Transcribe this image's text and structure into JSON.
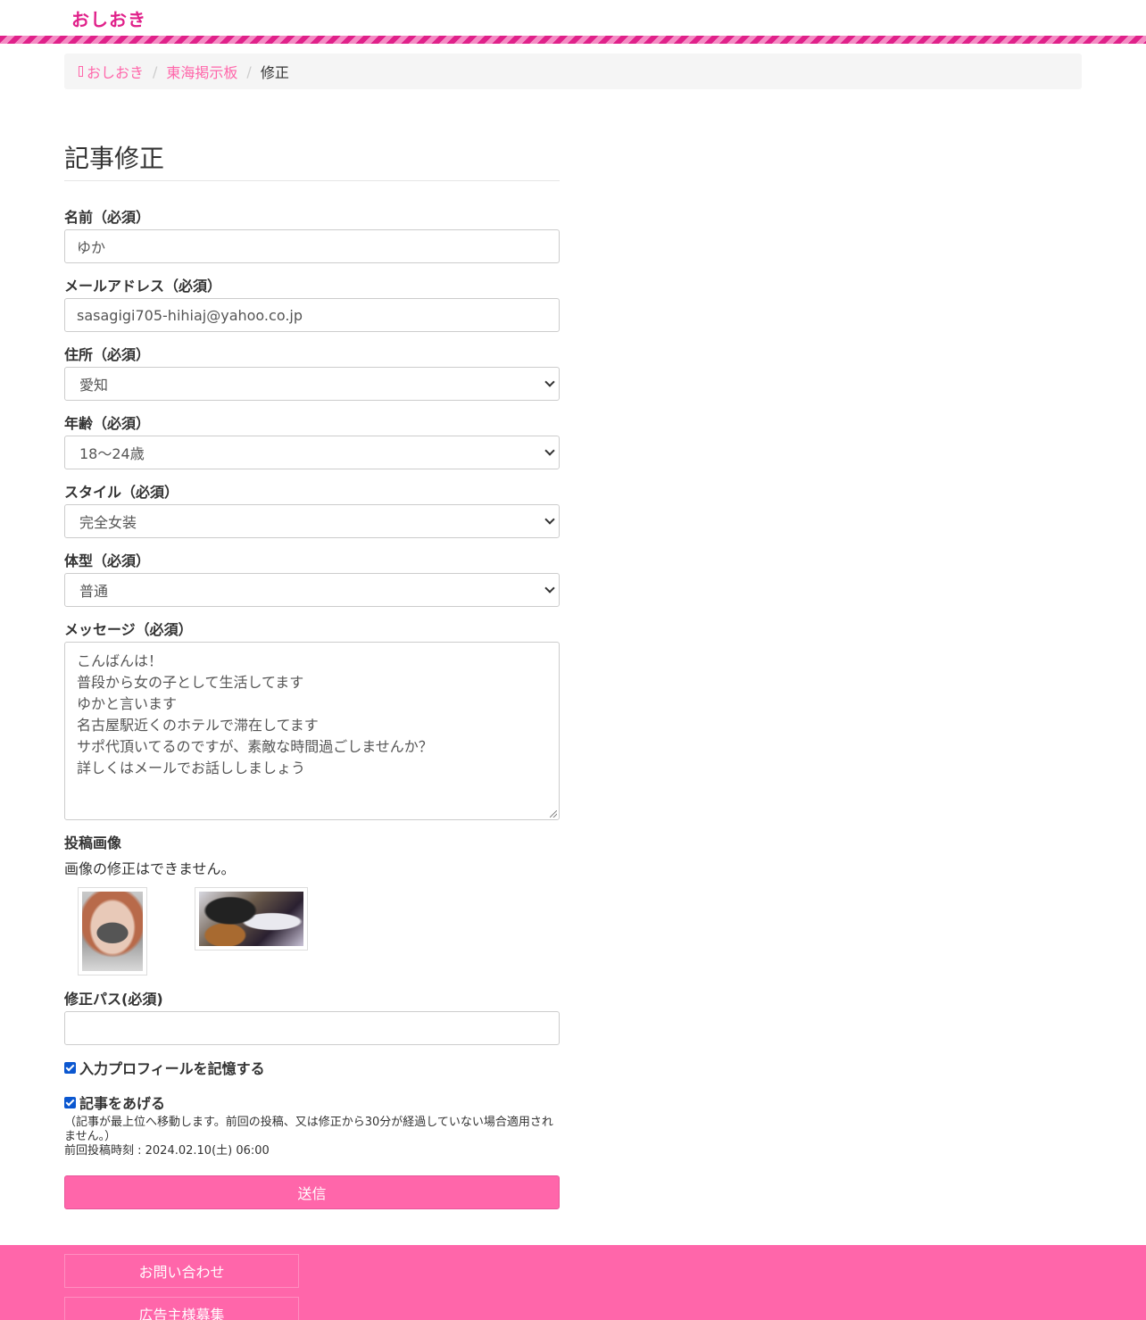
{
  "header": {
    "logo": "おしおき"
  },
  "breadcrumb": {
    "home": "おしおき",
    "board": "東海掲示板",
    "current": "修正"
  },
  "form": {
    "title": "記事修正",
    "name": {
      "label": "名前（必須）",
      "value": "ゆか"
    },
    "email": {
      "label": "メールアドレス（必須）",
      "value": "sasagigi705-hihiaj@yahoo.co.jp"
    },
    "address": {
      "label": "住所（必須）",
      "value": "愛知"
    },
    "age": {
      "label": "年齢（必須）",
      "value": "18〜24歳"
    },
    "style": {
      "label": "スタイル（必須）",
      "value": "完全女装"
    },
    "body_type": {
      "label": "体型（必須）",
      "value": "普通"
    },
    "message": {
      "label": "メッセージ（必須）",
      "lines": [
        "こんばんは！",
        "普段から女の子として生活してます",
        "ゆかと言います",
        "名古屋駅近くのホテルで滞在してます",
        "サポ代頂いてるのですが、素敵な時間過ごしませんか？",
        "詳しくはメールでお話ししましょう"
      ]
    },
    "images": {
      "label": "投稿画像",
      "note": "画像の修正はできません。"
    },
    "edit_pass": {
      "label": "修正パス(必須)",
      "value": ""
    },
    "remember": {
      "label": "入力プロフィールを記憶する",
      "checked": true
    },
    "bump": {
      "label": "記事をあげる",
      "checked": true,
      "note": "（記事が最上位へ移動します。前回の投稿、又は修正から30分が経過していない場合適用されません。）",
      "last_post": "前回投稿時刻 : 2024.02.10(土) 06:00"
    },
    "submit_label": "送信"
  },
  "footer": {
    "links": [
      "お問い合わせ",
      "広告主様募集"
    ]
  },
  "colors": {
    "accent": "#ff66aa",
    "logo": "#e0218a"
  }
}
